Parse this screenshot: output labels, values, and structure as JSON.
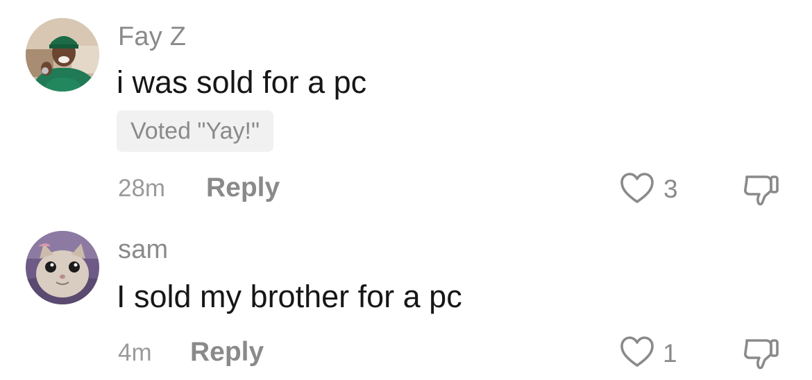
{
  "comments": [
    {
      "username": "Fay Z",
      "text": "i was sold for a pc",
      "vote_badge": "Voted \"Yay!\"",
      "time": "28m",
      "reply_label": "Reply",
      "likes": "3",
      "avatar_icon": "user-avatar-photo",
      "like_icon": "heart-outline-icon",
      "dislike_icon": "thumbs-down-outline-icon"
    },
    {
      "username": "sam",
      "text": "I sold my brother for a pc",
      "time": "4m",
      "reply_label": "Reply",
      "likes": "1",
      "avatar_icon": "kitten-avatar-photo",
      "like_icon": "heart-outline-icon",
      "dislike_icon": "thumbs-down-outline-icon"
    }
  ],
  "colors": {
    "text": "#161616",
    "muted": "#8a8a8a",
    "badge_bg": "#f1f1f2",
    "background": "#ffffff"
  }
}
